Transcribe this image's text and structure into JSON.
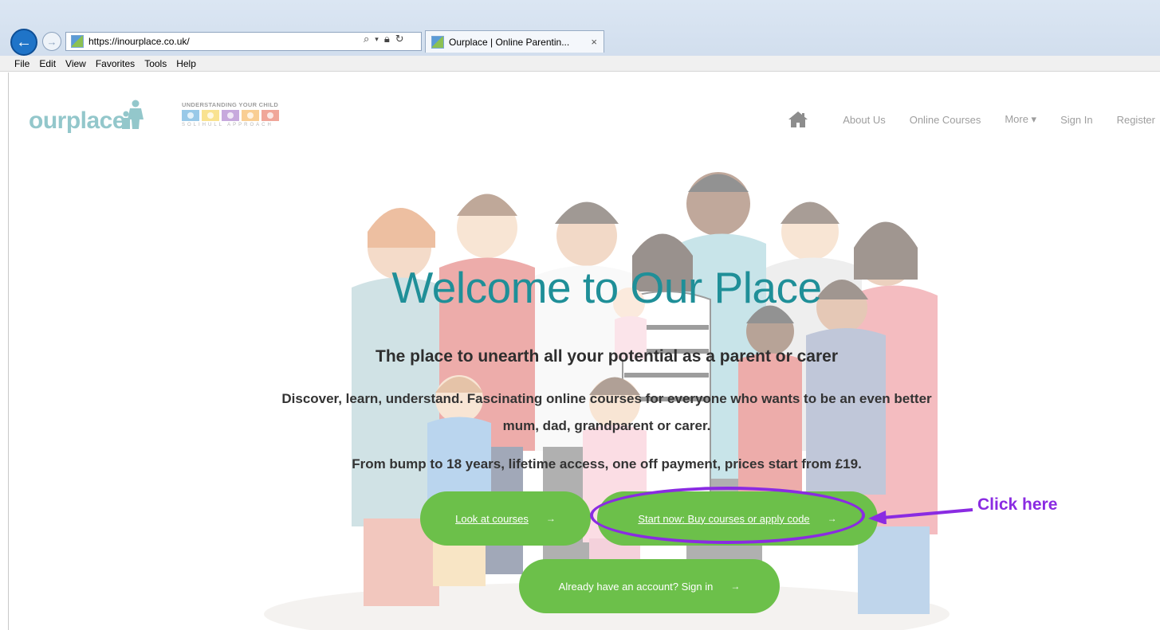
{
  "browser": {
    "url": "https://inourplace.co.uk/",
    "tab_title": "Ourplace | Online Parentin...",
    "tab_close": "×",
    "menu": [
      "File",
      "Edit",
      "View",
      "Favorites",
      "Tools",
      "Help"
    ],
    "tool_icons": [
      "search-icon",
      "lock-icon",
      "refresh-icon"
    ]
  },
  "header": {
    "logo_text": "ourplace",
    "partner_logo": {
      "title": "UNDERSTANDING YOUR CHILD",
      "subtitle": "SOLIHULL APPROACH",
      "colors": [
        "#2a8fd0",
        "#f2c318",
        "#8a4bb8",
        "#f29a1f",
        "#e0452b"
      ]
    },
    "nav": {
      "about": "About Us",
      "courses": "Online Courses",
      "more": "More ▾",
      "signin": "Sign In",
      "register": "Register"
    }
  },
  "hero": {
    "title": "Welcome to Our Place",
    "subtitle": "The place to unearth all your potential as a parent or carer",
    "description": "Discover, learn, understand. Fascinating online courses for everyone who wants to be an even better mum, dad, grandparent or carer.",
    "price_line": "From bump to 18 years, lifetime access, one off payment, prices start from £19.",
    "buttons": {
      "look": "Look at courses",
      "start": "Start now: Buy courses or apply code",
      "signin": "Already have an account? Sign in",
      "arrow": "→"
    }
  },
  "annotation": {
    "text": "Click here",
    "color": "#8a2be2"
  },
  "colors": {
    "brand_teal": "#1f8f98",
    "button_green": "#6cc04a"
  }
}
